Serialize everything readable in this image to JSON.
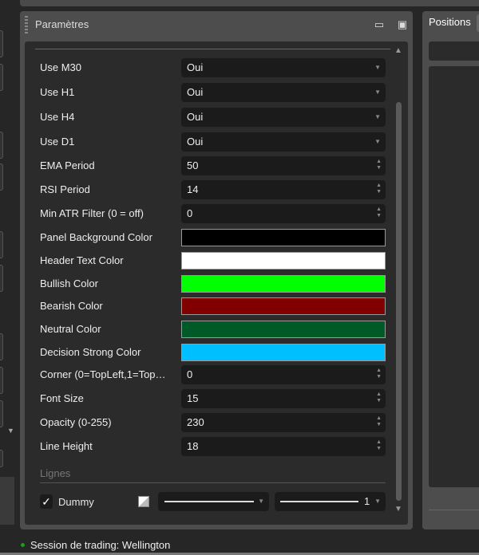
{
  "panel": {
    "title": "Paramètres",
    "icons": [
      "folder-open-icon",
      "save-icon"
    ]
  },
  "rows": [
    {
      "label": "Use M30",
      "type": "select",
      "value": "Oui"
    },
    {
      "label": "Use H1",
      "type": "select",
      "value": "Oui"
    },
    {
      "label": "Use H4",
      "type": "select",
      "value": "Oui"
    },
    {
      "label": "Use D1",
      "type": "select",
      "value": "Oui"
    },
    {
      "label": "EMA Period",
      "type": "number",
      "value": "50"
    },
    {
      "label": "RSI Period",
      "type": "number",
      "value": "14"
    },
    {
      "label": "Min ATR Filter (0 = off)",
      "type": "number",
      "value": "0"
    },
    {
      "label": "Panel Background Color",
      "type": "color",
      "value": "#000000"
    },
    {
      "label": "Header Text Color",
      "type": "color",
      "value": "#ffffff"
    },
    {
      "label": "Bullish Color",
      "type": "color",
      "value": "#00ff00"
    },
    {
      "label": "Bearish Color",
      "type": "color",
      "value": "#800000"
    },
    {
      "label": "Neutral Color",
      "type": "color",
      "value": "#005a28"
    },
    {
      "label": "Decision Strong Color",
      "type": "color",
      "value": "#00bfff"
    },
    {
      "label": "Corner (0=TopLeft,1=Top…",
      "type": "number",
      "value": "0"
    },
    {
      "label": "Font Size",
      "type": "number",
      "value": "15"
    },
    {
      "label": "Opacity (0-255)",
      "type": "number",
      "value": "230"
    },
    {
      "label": "Line Height",
      "type": "number",
      "value": "18"
    }
  ],
  "lines_section": {
    "title": "Lignes",
    "item": {
      "label": "Dummy",
      "checked": true,
      "width": "1"
    }
  },
  "right_panel": {
    "title": "Positions"
  },
  "status": {
    "text": "Session de trading: Wellington",
    "color": "#1c9c1c"
  }
}
